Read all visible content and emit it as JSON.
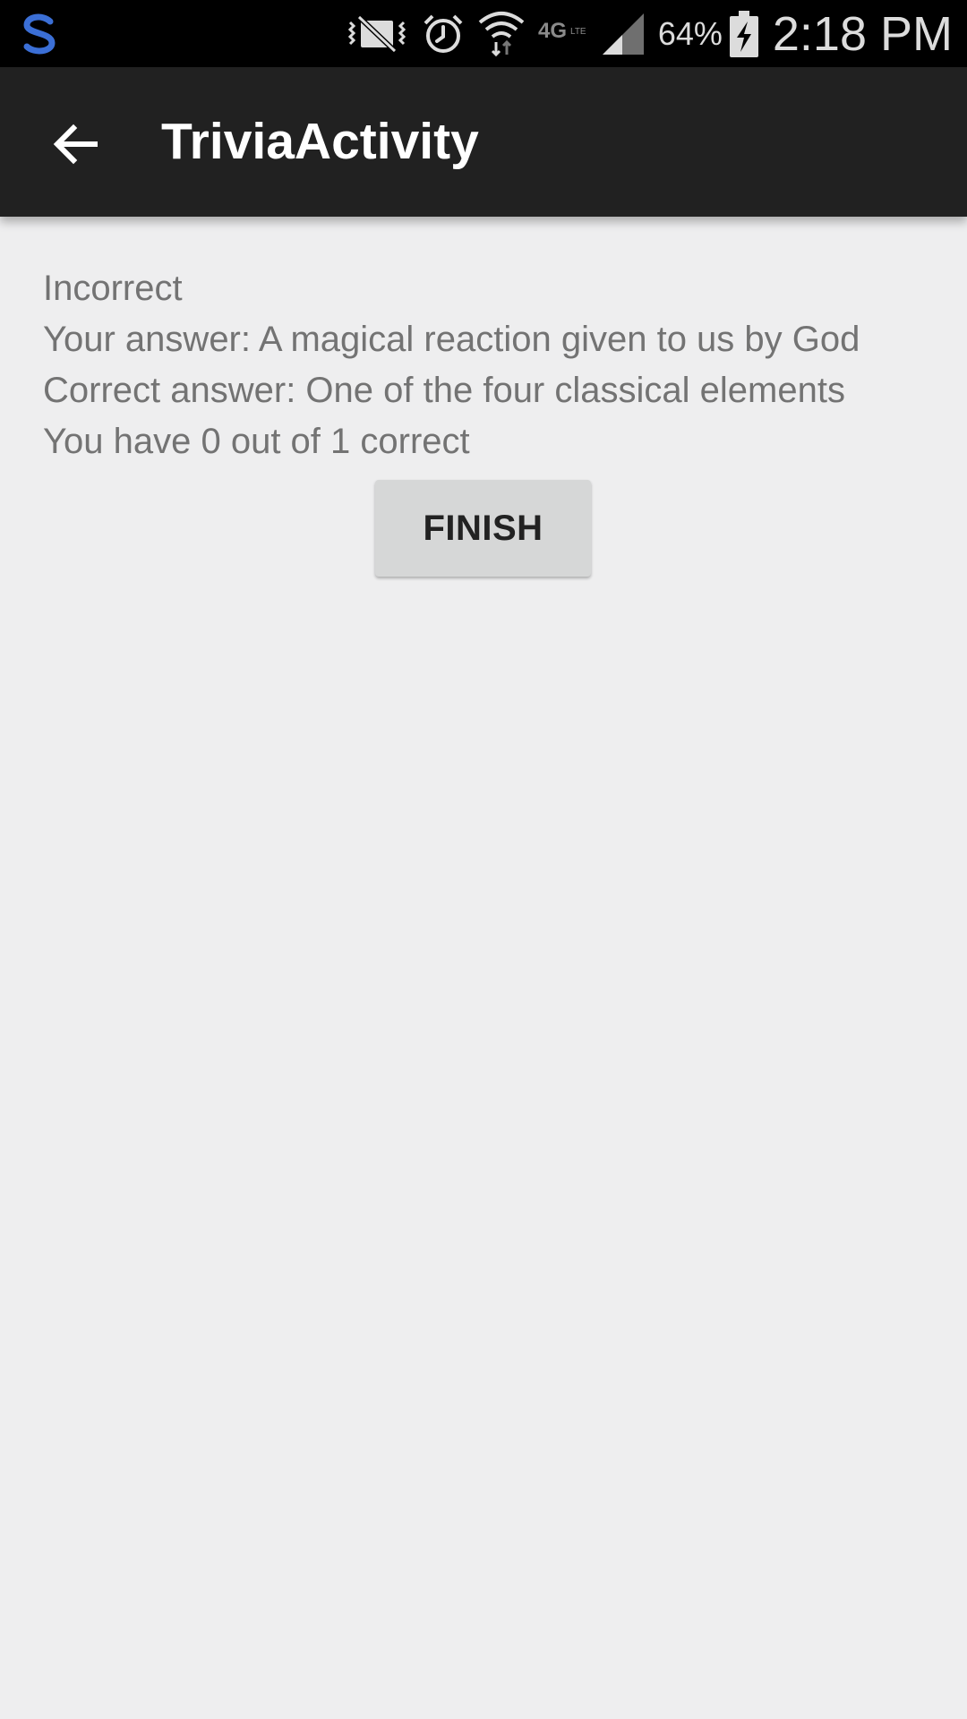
{
  "status_bar": {
    "icons": [
      "s-app-icon",
      "vibrate-mute-icon",
      "alarm-icon",
      "wifi-icon",
      "4g-lte-icon",
      "signal-icon"
    ],
    "battery_percent": "64%",
    "battery_icon": "battery-charging-icon",
    "clock": "2:18 PM"
  },
  "toolbar": {
    "back_icon": "arrow-back-icon",
    "title": "TriviaActivity"
  },
  "result": {
    "status": "Incorrect",
    "your_answer": "Your answer: A magical reaction given to us by God",
    "correct_answer": "Correct answer: One of the four classical elements",
    "score": "You have 0 out of 1 correct"
  },
  "finish_button": {
    "label": "FINISH"
  },
  "colors": {
    "background": "#eeeeef",
    "toolbar": "#212121",
    "status_bar": "#000000",
    "text": "#737373",
    "button": "#d6d7d7",
    "app_icon_blue": "#3b6fd6"
  }
}
